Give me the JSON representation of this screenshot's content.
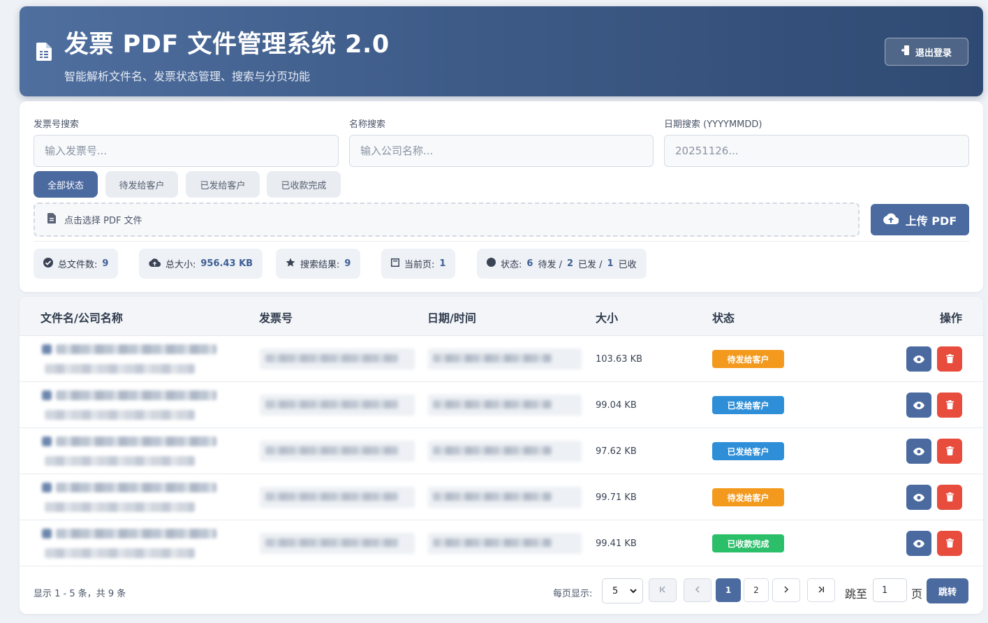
{
  "header": {
    "title": "发票 PDF 文件管理系统 2.0",
    "subtitle": "智能解析文件名、发票状态管理、搜索与分页功能",
    "logout_label": "退出登录",
    "icon": "file-document-icon"
  },
  "search": {
    "invoice_label": "发票号搜索",
    "invoice_placeholder": "输入发票号...",
    "name_label": "名称搜索",
    "name_placeholder": "输入公司名称...",
    "date_label": "日期搜索 (YYYYMMDD)",
    "date_placeholder": "20251126..."
  },
  "filters": [
    {
      "label": "全部状态",
      "active": true
    },
    {
      "label": "待发给客户",
      "active": false
    },
    {
      "label": "已发给客户",
      "active": false
    },
    {
      "label": "已收款完成",
      "active": false
    }
  ],
  "upload": {
    "placeholder": "点击选择 PDF 文件",
    "button_label": "上传 PDF"
  },
  "stats": {
    "total_files_label": "总文件数:",
    "total_files": "9",
    "total_size_label": "总大小:",
    "total_size": "956.43 KB",
    "search_results_label": "搜索结果:",
    "search_results": "9",
    "current_page_label": "当前页:",
    "current_page": "1",
    "status_label": "状态:",
    "pending_count": "6",
    "pending_text": "待发 /",
    "sent_count": "2",
    "sent_text": "已发 /",
    "paid_count": "1",
    "paid_text": "已收"
  },
  "table": {
    "columns": [
      "文件名/公司名称",
      "发票号",
      "日期/时间",
      "大小",
      "状态",
      "操作"
    ],
    "rows": [
      {
        "size": "103.63 KB",
        "status": "待发给客户",
        "status_type": "pending"
      },
      {
        "size": "99.04 KB",
        "status": "已发给客户",
        "status_type": "sent"
      },
      {
        "size": "97.62 KB",
        "status": "已发给客户",
        "status_type": "sent"
      },
      {
        "size": "99.71 KB",
        "status": "待发给客户",
        "status_type": "pending"
      },
      {
        "size": "99.41 KB",
        "status": "已收款完成",
        "status_type": "paid"
      }
    ]
  },
  "pagination": {
    "info": "显示 1 - 5 条，共 9 条",
    "per_page_label": "每页显示:",
    "per_page_value": "5",
    "first_icon": "first-page-icon",
    "prev_icon": "prev-page-icon",
    "pages": [
      "1",
      "2"
    ],
    "next_icon": "next-page-icon",
    "last_icon": "last-page-icon",
    "jump_label": "跳至",
    "jump_value": "1",
    "page_suffix": "页",
    "jump_button": "跳转"
  },
  "colors": {
    "primary": "#4a6aa0",
    "pending": "#f39a1e",
    "sent": "#2e8fd8",
    "paid": "#2bbf6a",
    "danger": "#e74c3c"
  }
}
